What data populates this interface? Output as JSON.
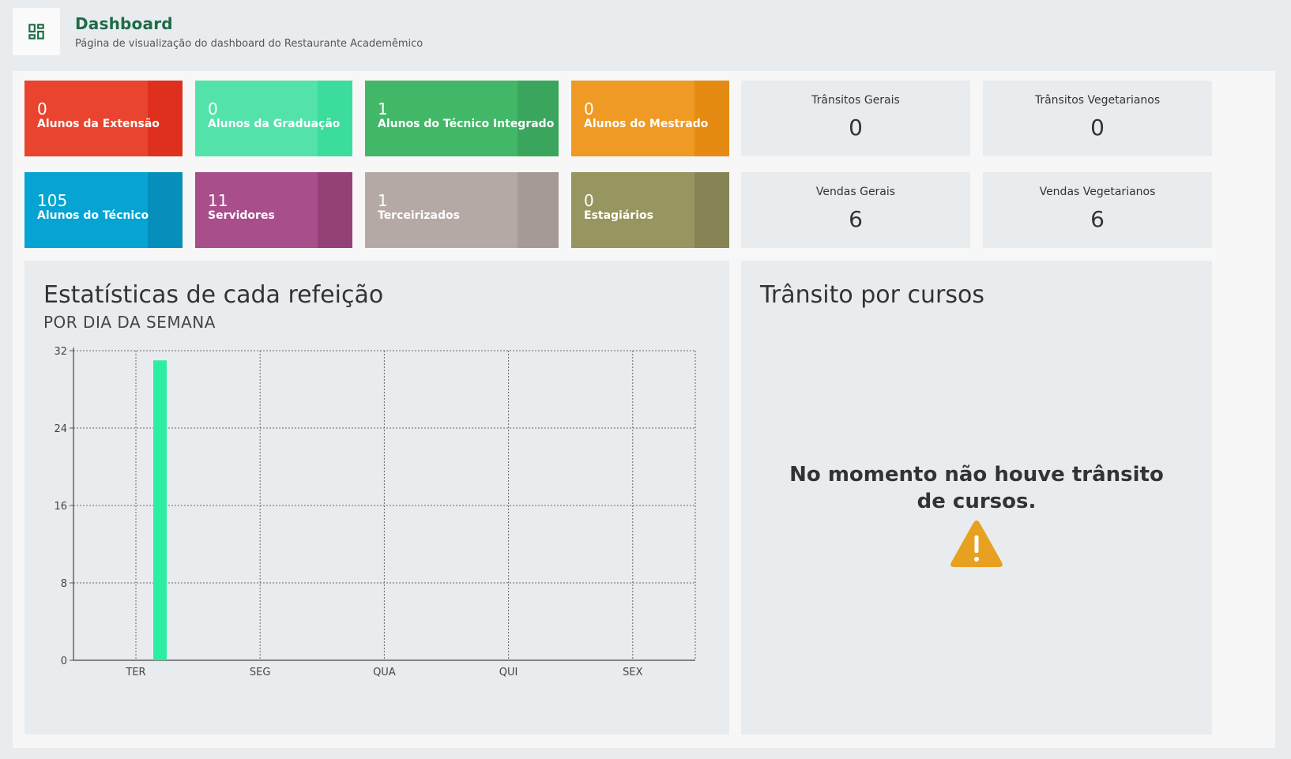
{
  "header": {
    "title": "Dashboard",
    "subtitle": "Página de visualização do dashboard do Restaurante Academêmico"
  },
  "tiles": [
    {
      "value": "0",
      "label": "Alunos da Extensão",
      "color": "#e8442f",
      "accent": "#df2f1d"
    },
    {
      "value": "0",
      "label": "Alunos da Graduação",
      "color": "#54e2ab",
      "accent": "#3cdc9c"
    },
    {
      "value": "1",
      "label": "Alunos do Técnico Integrado",
      "color": "#42b768",
      "accent": "#3aa65d"
    },
    {
      "value": "0",
      "label": "Alunos do Mestrado",
      "color": "#ee9a24",
      "accent": "#e58a12"
    },
    {
      "value": "105",
      "label": "Alunos do Técnico",
      "color": "#05a4d2",
      "accent": "#058fba"
    },
    {
      "value": "11",
      "label": "Servidores",
      "color": "#a84e8b",
      "accent": "#944178"
    },
    {
      "value": "1",
      "label": "Terceirizados",
      "color": "#b5a9a6",
      "accent": "#a69a97"
    },
    {
      "value": "0",
      "label": "Estagiários",
      "color": "#979560",
      "accent": "#868454"
    }
  ],
  "stats": [
    {
      "title": "Trânsitos Gerais",
      "value": "0"
    },
    {
      "title": "Trânsitos Vegetarianos",
      "value": "0"
    },
    {
      "title": "Vendas Gerais",
      "value": "6"
    },
    {
      "title": "Vendas Vegetarianos",
      "value": "6"
    }
  ],
  "meal_chart": {
    "title": "Estatísticas de cada refeição",
    "subtitle": "POR DIA DA SEMANA"
  },
  "transit_card": {
    "title": "Trânsito por cursos",
    "empty_message": "No momento não houve trânsito de cursos.",
    "icon": "warning-triangle-icon",
    "icon_color": "#e8a020"
  },
  "colors": {
    "brand": "#1e6b47",
    "bar": "#2ceea3"
  },
  "chart_data": {
    "type": "bar",
    "title": "Estatísticas de cada refeição",
    "subtitle": "POR DIA DA SEMANA",
    "categories": [
      "TER",
      "SEG",
      "QUA",
      "QUI",
      "SEX"
    ],
    "series": [
      {
        "values": [
          31,
          0,
          0,
          0,
          0
        ]
      }
    ],
    "ylim": [
      0,
      32
    ],
    "yticks": [
      0,
      8,
      16,
      24,
      32
    ],
    "grid": true
  }
}
